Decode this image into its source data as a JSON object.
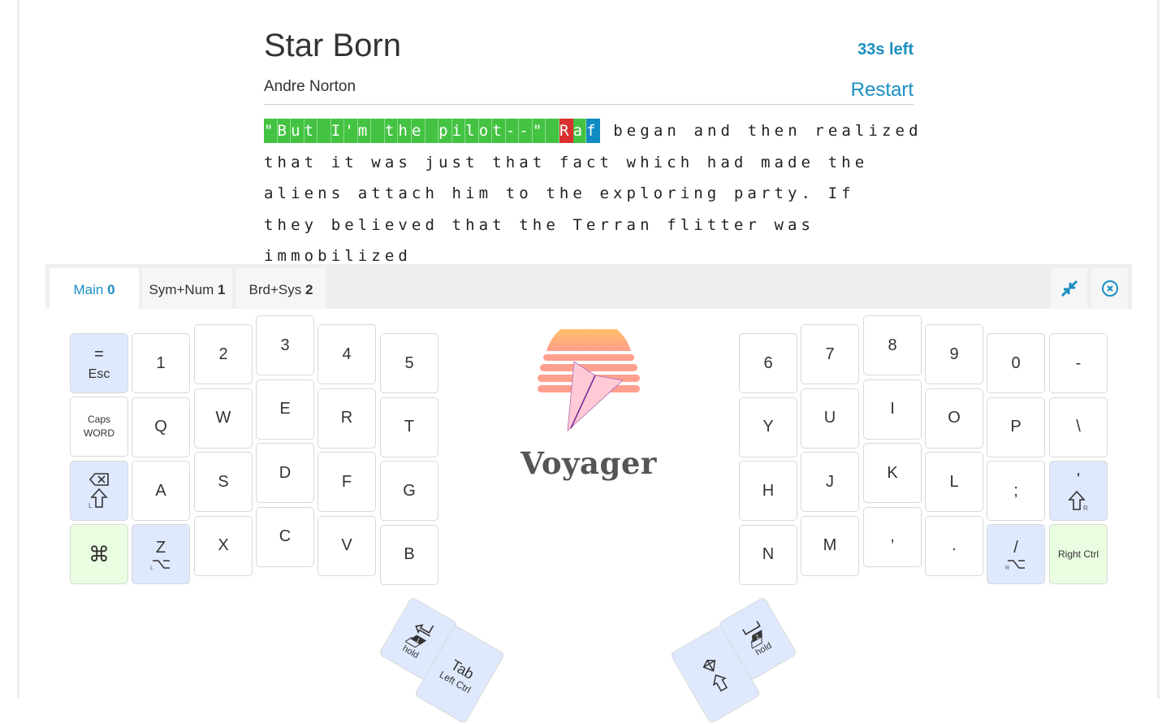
{
  "book": {
    "title": "Star Born",
    "author": "Andre Norton",
    "timer": "33s left",
    "restart_label": "Restart"
  },
  "passage": {
    "segments": [
      {
        "text": "\"But I'm the pilot--\" ",
        "state": "correct"
      },
      {
        "text": "R",
        "state": "error"
      },
      {
        "text": "a",
        "state": "correct"
      },
      {
        "text": "f",
        "state": "cursor"
      },
      {
        "text": " began and then realized",
        "state": "pending"
      }
    ],
    "lines": [
      "that it was just that fact which had made the",
      "aliens attach him to the exploring party. If",
      "they believed that the Terran flitter was immobilized"
    ]
  },
  "colors": {
    "correct": "#44c342",
    "error": "#d9302f",
    "cursor": "#0f8bc1",
    "accent": "#1a8fc1",
    "modifier_key": "#dfe9fd",
    "ctrl_key": "#e9fde0"
  },
  "layers": [
    {
      "name": "Main",
      "num": "0",
      "active": true
    },
    {
      "name": "Sym+Num",
      "num": "1"
    },
    {
      "name": "Brd+Sys",
      "num": "2"
    }
  ],
  "logo": {
    "text": "Voyager"
  },
  "left_keys": [
    [
      "= ",
      "1",
      "2",
      "3",
      "4",
      "5"
    ],
    [
      "Caps WORD",
      "Q",
      "W",
      "E",
      "R",
      "T"
    ],
    [
      "backspace/shift",
      "A",
      "S",
      "D",
      "F",
      "G"
    ],
    [
      "cmd",
      "Z",
      "X",
      "C",
      "V",
      "B"
    ]
  ],
  "keys": {
    "esc_top": "=",
    "esc": "Esc",
    "caps": "Caps",
    "word": "WORD",
    "row0L": [
      "1",
      "2",
      "3",
      "4",
      "5"
    ],
    "row1L": [
      "Q",
      "W",
      "E",
      "R",
      "T"
    ],
    "row2L": [
      "A",
      "S",
      "D",
      "F",
      "G"
    ],
    "row3L": [
      "X",
      "C",
      "V",
      "B"
    ],
    "z": "Z",
    "row0R": [
      "6",
      "7",
      "8",
      "9",
      "0",
      "-"
    ],
    "row1R": [
      "Y",
      "U",
      "I",
      "O",
      "P",
      "\\"
    ],
    "row2R": [
      "H",
      "J",
      "K",
      "L",
      ";"
    ],
    "quote": "'",
    "row3R": [
      "N",
      "M",
      ",",
      "."
    ],
    "slash": "/",
    "right_ctrl": "Right Ctrl",
    "thumb_left": {
      "hold": "hold",
      "layer": "1",
      "tab": "Tab",
      "tab_sub": "Left Ctrl"
    },
    "thumb_right": {
      "hold": "hold",
      "layer": "2"
    }
  }
}
